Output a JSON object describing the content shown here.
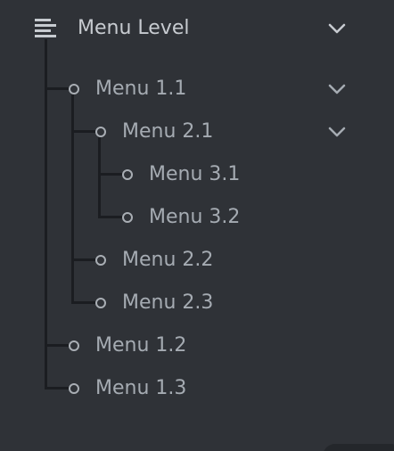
{
  "menu": {
    "title": "Menu Level",
    "items": {
      "m11": "Menu 1.1",
      "m21": "Menu 2.1",
      "m31": "Menu 3.1",
      "m32": "Menu 3.2",
      "m22": "Menu 2.2",
      "m23": "Menu 2.3",
      "m12": "Menu 1.2",
      "m13": "Menu 1.3"
    },
    "icons": {
      "menu": "align-left-icon",
      "expand": "chevron-down-icon",
      "bullet": "circle-bullet-icon"
    }
  },
  "theme": {
    "background": "#2f3237",
    "tree_line": "#1b1d21",
    "text": "#a5abb2",
    "title_text": "#c7cbd0"
  }
}
